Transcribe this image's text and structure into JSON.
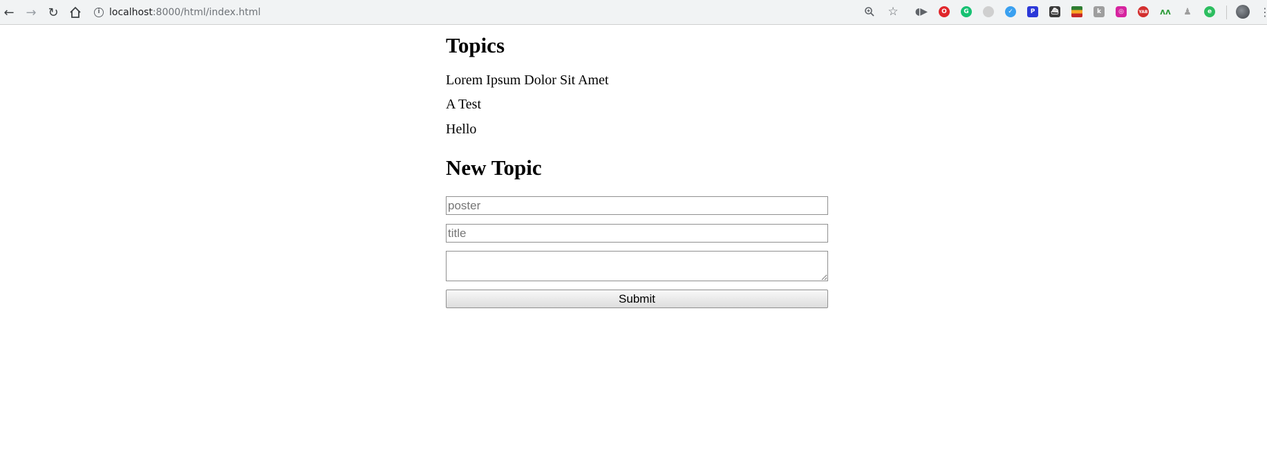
{
  "browser": {
    "url_host": "localhost",
    "url_path": ":8000/html/index.html",
    "icons": {
      "back": "back-arrow-icon",
      "forward": "forward-arrow-icon",
      "reload": "reload-icon",
      "home": "home-icon",
      "info": "info-icon",
      "zoom": "zoom-icon",
      "bookmark": "star-icon",
      "menu": "kebab-menu-icon"
    }
  },
  "topics": {
    "title": "Topics",
    "items": [
      "Lorem Ipsum Dolor Sit Amet",
      "A Test",
      "Hello"
    ]
  },
  "new_topic": {
    "title": "New Topic",
    "poster_placeholder": "poster",
    "title_placeholder": "title",
    "body_value": "",
    "submit_label": "Submit"
  }
}
